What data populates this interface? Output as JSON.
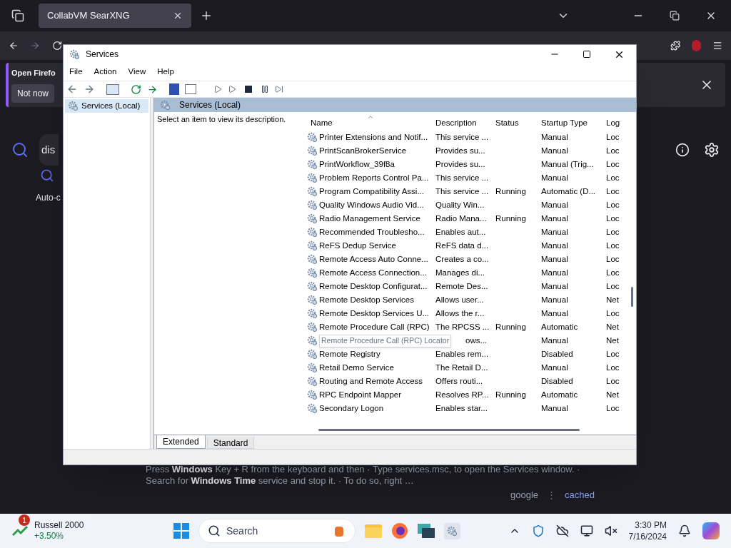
{
  "browser": {
    "tab": {
      "title": "CollabVM SearXNG",
      "selected": true
    },
    "notification": {
      "text": "Open Firefo",
      "button": "Not now"
    },
    "search": {
      "value": "dis"
    },
    "page": {
      "autocomplete": "Auto-c",
      "snippet": [
        "Press **Windows** Key + R from the keyboard and then · Type services.msc, to open the Services window. ·",
        "Search for **Windows Time** service and stop it. · To do so, right …"
      ],
      "engine": "google",
      "separator": "⋮",
      "cached": "cached"
    }
  },
  "window": {
    "title": "Services",
    "menu": [
      "File",
      "Action",
      "View",
      "Help"
    ],
    "tree": [
      {
        "label": "Services (Local)",
        "selected": true
      }
    ],
    "header": "Services (Local)",
    "description": "Select an item to view its description.",
    "table": {
      "columns": [
        "Name",
        "Description",
        "Status",
        "Startup Type",
        "Log"
      ],
      "rows": [
        {
          "name": "Printer Extensions and Notif...",
          "description": "This service ...",
          "status": "",
          "startup": "Manual",
          "logon": "Loc"
        },
        {
          "name": "PrintScanBrokerService",
          "description": "Provides su...",
          "startup": "Manual",
          "logon": "Loc"
        },
        {
          "name": "PrintWorkflow_39f8a",
          "description": "Provides su...",
          "startup": "Manual (Trig...",
          "logon": "Loc"
        },
        {
          "name": "Problem Reports Control Pa...",
          "description": "This service ...",
          "startup": "Manual",
          "logon": "Loc"
        },
        {
          "name": "Program Compatibility Assi...",
          "description": "This service ...",
          "status": "Running",
          "startup": "Automatic (D...",
          "logon": "Loc"
        },
        {
          "name": "Quality Windows Audio Vid...",
          "description": "Quality Win...",
          "startup": "Manual",
          "logon": "Loc"
        },
        {
          "name": "Radio Management Service",
          "description": "Radio Mana...",
          "status": "Running",
          "startup": "Manual",
          "logon": "Loc"
        },
        {
          "name": "Recommended Troublesho...",
          "description": "Enables aut...",
          "startup": "Manual",
          "logon": "Loc"
        },
        {
          "name": "ReFS Dedup Service",
          "description": "ReFS data d...",
          "startup": "Manual",
          "logon": "Loc"
        },
        {
          "name": "Remote Access Auto Conne...",
          "description": "Creates a co...",
          "startup": "Manual",
          "logon": "Loc"
        },
        {
          "name": "Remote Access Connection...",
          "description": "Manages di...",
          "startup": "Manual",
          "logon": "Loc"
        },
        {
          "name": "Remote Desktop Configurat...",
          "description": "Remote Des...",
          "startup": "Manual",
          "logon": "Loc"
        },
        {
          "name": "Remote Desktop Services",
          "description": "Allows user...",
          "startup": "Manual",
          "logon": "Net"
        },
        {
          "name": "Remote Desktop Services U...",
          "description": "Allows the r...",
          "startup": "Manual",
          "logon": "Loc"
        },
        {
          "name": "Remote Procedure Call (RPC)",
          "description": "The RPCSS ...",
          "status": "Running",
          "startup": "Automatic",
          "logon": "Net"
        },
        {
          "kind": "tooltip",
          "name": "Remote Procedure Call (RPC) Locator",
          "description": "ows...",
          "startup": "Manual",
          "logon": "Net"
        },
        {
          "name": "Remote Registry",
          "description": "Enables rem...",
          "startup": "Disabled",
          "logon": "Loc"
        },
        {
          "name": "Retail Demo Service",
          "description": "The Retail D...",
          "startup": "Manual",
          "logon": "Loc"
        },
        {
          "name": "Routing and Remote Access",
          "description": "Offers routi...",
          "startup": "Disabled",
          "logon": "Loc"
        },
        {
          "name": "RPC Endpoint Mapper",
          "description": "Resolves RP...",
          "status": "Running",
          "startup": "Automatic",
          "logon": "Net"
        },
        {
          "name": "Secondary Logon",
          "description": "Enables star...",
          "startup": "Manual",
          "logon": "Loc"
        }
      ]
    },
    "view_tabs": [
      {
        "label": "Extended",
        "selected": true
      },
      {
        "label": "Standard",
        "selected": false
      }
    ]
  },
  "taskbar": {
    "widget": {
      "title": "Russell 2000",
      "change": "+3.50%",
      "badge": "1"
    },
    "search": "Search",
    "time": "3:30 PM",
    "date": "7/16/2024"
  }
}
